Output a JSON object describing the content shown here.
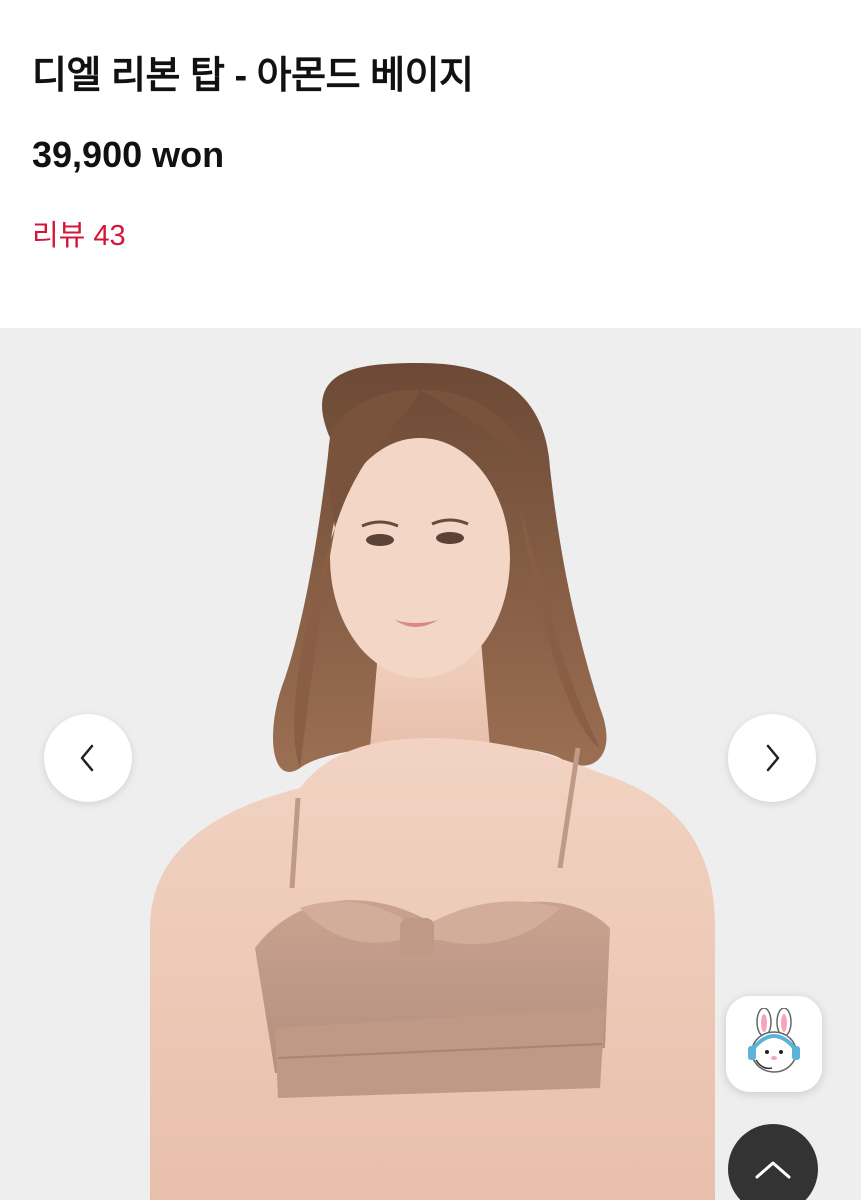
{
  "product": {
    "title": "디엘 리본 탑 - 아몬드 베이지",
    "price": "39,900 won",
    "review_link": "리뷰 43"
  },
  "gallery": {
    "image": "model-wearing-almond-beige-ribbon-bra-top",
    "prev_icon": "chevron-left-icon",
    "next_icon": "chevron-right-icon"
  },
  "floating": {
    "chat_icon": "bunny-headset-chat-icon",
    "top_icon": "chevron-up-icon"
  },
  "colors": {
    "review_accent": "#d2173a",
    "gallery_bg": "#eeeeee",
    "top_button": "#333333",
    "product_beige": "#c9a290"
  }
}
